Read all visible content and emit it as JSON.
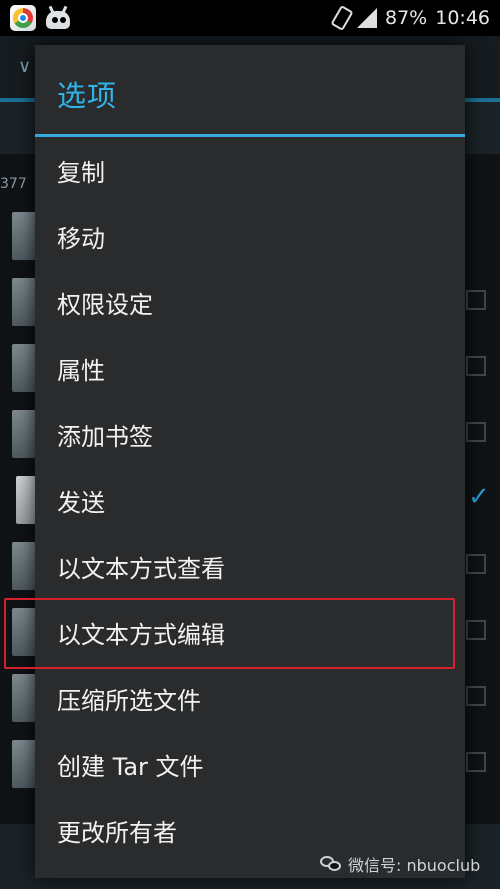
{
  "status_bar": {
    "battery": "87%",
    "time": "10:46",
    "icons": [
      "app-icon",
      "robot-icon",
      "rotate-icon",
      "signal-icon"
    ]
  },
  "background": {
    "path_text": "377"
  },
  "dialog": {
    "title": "选项",
    "items": [
      {
        "label": "复制"
      },
      {
        "label": "移动"
      },
      {
        "label": "权限设定"
      },
      {
        "label": "属性"
      },
      {
        "label": "添加书签"
      },
      {
        "label": "发送"
      },
      {
        "label": "以文本方式查看"
      },
      {
        "label": "以文本方式编辑"
      },
      {
        "label": "压缩所选文件"
      },
      {
        "label": "创建 Tar 文件"
      },
      {
        "label": "更改所有者"
      }
    ],
    "highlighted_index": 7,
    "accent_color": "#35a9db",
    "highlight_color": "#d6202e"
  },
  "watermark": {
    "text": "微信号: nbuoclub"
  }
}
